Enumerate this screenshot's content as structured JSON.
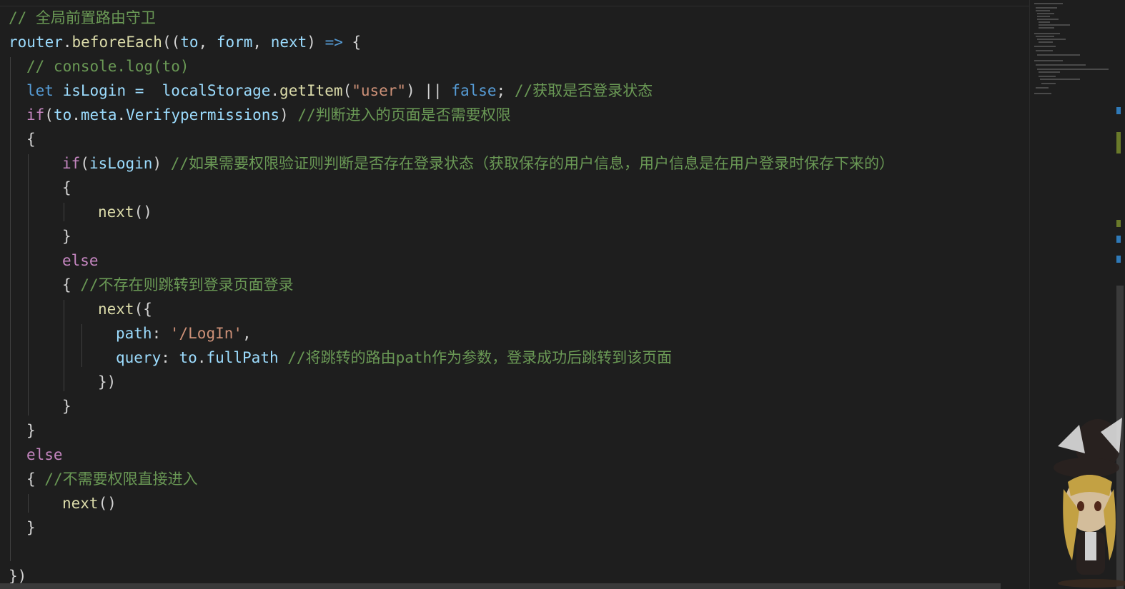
{
  "editor": {
    "lines": [
      {
        "indent": 0,
        "tokens": [
          {
            "t": "// 全局前置路由守卫",
            "c": "comment"
          }
        ]
      },
      {
        "indent": 0,
        "tokens": [
          {
            "t": "router",
            "c": "var"
          },
          {
            "t": ".",
            "c": "punct"
          },
          {
            "t": "beforeEach",
            "c": "fn"
          },
          {
            "t": "((",
            "c": "punct"
          },
          {
            "t": "to",
            "c": "var"
          },
          {
            "t": ", ",
            "c": "punct"
          },
          {
            "t": "form",
            "c": "var"
          },
          {
            "t": ", ",
            "c": "punct"
          },
          {
            "t": "next",
            "c": "var"
          },
          {
            "t": ") ",
            "c": "punct"
          },
          {
            "t": "=>",
            "c": "keyword"
          },
          {
            "t": " {",
            "c": "punct"
          }
        ]
      },
      {
        "indent": 1,
        "tokens": [
          {
            "t": "// console.log(to)",
            "c": "comment"
          }
        ]
      },
      {
        "indent": 1,
        "tokens": [
          {
            "t": "let",
            "c": "keyword"
          },
          {
            "t": " isLogin = ",
            "c": "var"
          },
          {
            "t": " localStorage",
            "c": "var"
          },
          {
            "t": ".",
            "c": "punct"
          },
          {
            "t": "getItem",
            "c": "fn"
          },
          {
            "t": "(",
            "c": "punct"
          },
          {
            "t": "\"user\"",
            "c": "string"
          },
          {
            "t": ") || ",
            "c": "punct"
          },
          {
            "t": "false",
            "c": "bool"
          },
          {
            "t": "; ",
            "c": "punct"
          },
          {
            "t": "//获取是否登录状态",
            "c": "comment"
          }
        ]
      },
      {
        "indent": 1,
        "tokens": [
          {
            "t": "if",
            "c": "control"
          },
          {
            "t": "(",
            "c": "punct"
          },
          {
            "t": "to",
            "c": "var"
          },
          {
            "t": ".",
            "c": "punct"
          },
          {
            "t": "meta",
            "c": "var"
          },
          {
            "t": ".",
            "c": "punct"
          },
          {
            "t": "Verifypermissions",
            "c": "var"
          },
          {
            "t": ") ",
            "c": "punct"
          },
          {
            "t": "//判断进入的页面是否需要权限",
            "c": "comment"
          }
        ]
      },
      {
        "indent": 1,
        "tokens": [
          {
            "t": "{",
            "c": "punct"
          }
        ]
      },
      {
        "indent": 3,
        "tokens": [
          {
            "t": "if",
            "c": "control"
          },
          {
            "t": "(",
            "c": "punct"
          },
          {
            "t": "isLogin",
            "c": "var"
          },
          {
            "t": ") ",
            "c": "punct"
          },
          {
            "t": "//如果需要权限验证则判断是否存在登录状态（获取保存的用户信息，用户信息是在用户登录时保存下来的）",
            "c": "comment"
          }
        ]
      },
      {
        "indent": 3,
        "tokens": [
          {
            "t": "{",
            "c": "punct"
          }
        ]
      },
      {
        "indent": 5,
        "tokens": [
          {
            "t": "next",
            "c": "fn"
          },
          {
            "t": "()",
            "c": "punct"
          }
        ]
      },
      {
        "indent": 3,
        "tokens": [
          {
            "t": "}",
            "c": "punct"
          }
        ]
      },
      {
        "indent": 3,
        "tokens": [
          {
            "t": "else",
            "c": "control"
          }
        ]
      },
      {
        "indent": 3,
        "tokens": [
          {
            "t": "{ ",
            "c": "punct"
          },
          {
            "t": "//不存在则跳转到登录页面登录",
            "c": "comment"
          }
        ]
      },
      {
        "indent": 5,
        "tokens": [
          {
            "t": "next",
            "c": "fn"
          },
          {
            "t": "({",
            "c": "punct"
          }
        ]
      },
      {
        "indent": 6,
        "tokens": [
          {
            "t": "path",
            "c": "var"
          },
          {
            "t": ": ",
            "c": "punct"
          },
          {
            "t": "'/LogIn'",
            "c": "string"
          },
          {
            "t": ",",
            "c": "punct"
          }
        ]
      },
      {
        "indent": 6,
        "tokens": [
          {
            "t": "query",
            "c": "var"
          },
          {
            "t": ": ",
            "c": "punct"
          },
          {
            "t": "to",
            "c": "var"
          },
          {
            "t": ".",
            "c": "punct"
          },
          {
            "t": "fullPath",
            "c": "var"
          },
          {
            "t": " ",
            "c": "punct"
          },
          {
            "t": "//将跳转的路由path作为参数，登录成功后跳转到该页面",
            "c": "comment"
          }
        ]
      },
      {
        "indent": 5,
        "tokens": [
          {
            "t": "})",
            "c": "punct"
          }
        ]
      },
      {
        "indent": 3,
        "tokens": [
          {
            "t": "}",
            "c": "punct"
          }
        ]
      },
      {
        "indent": 1,
        "tokens": [
          {
            "t": "}",
            "c": "punct"
          }
        ]
      },
      {
        "indent": 1,
        "tokens": [
          {
            "t": "else",
            "c": "control"
          }
        ]
      },
      {
        "indent": 1,
        "tokens": [
          {
            "t": "{ ",
            "c": "punct"
          },
          {
            "t": "//不需要权限直接进入",
            "c": "comment"
          }
        ]
      },
      {
        "indent": 3,
        "tokens": [
          {
            "t": "next",
            "c": "fn"
          },
          {
            "t": "()",
            "c": "punct"
          }
        ]
      },
      {
        "indent": 1,
        "tokens": [
          {
            "t": "}",
            "c": "punct"
          }
        ]
      },
      {
        "indent": 0,
        "tokens": []
      },
      {
        "indent": 0,
        "tokens": [
          {
            "t": "})",
            "c": "punct"
          }
        ]
      }
    ]
  },
  "colors": {
    "background": "#1e1e1e",
    "comment": "#6a9955",
    "keyword": "#569cd6",
    "control": "#c586c0",
    "variable": "#9cdcfe",
    "function": "#dcdcaa",
    "string": "#ce9178"
  },
  "minimap": {
    "visible": true
  },
  "decoration": {
    "sticker": "chibi-witch-character"
  }
}
